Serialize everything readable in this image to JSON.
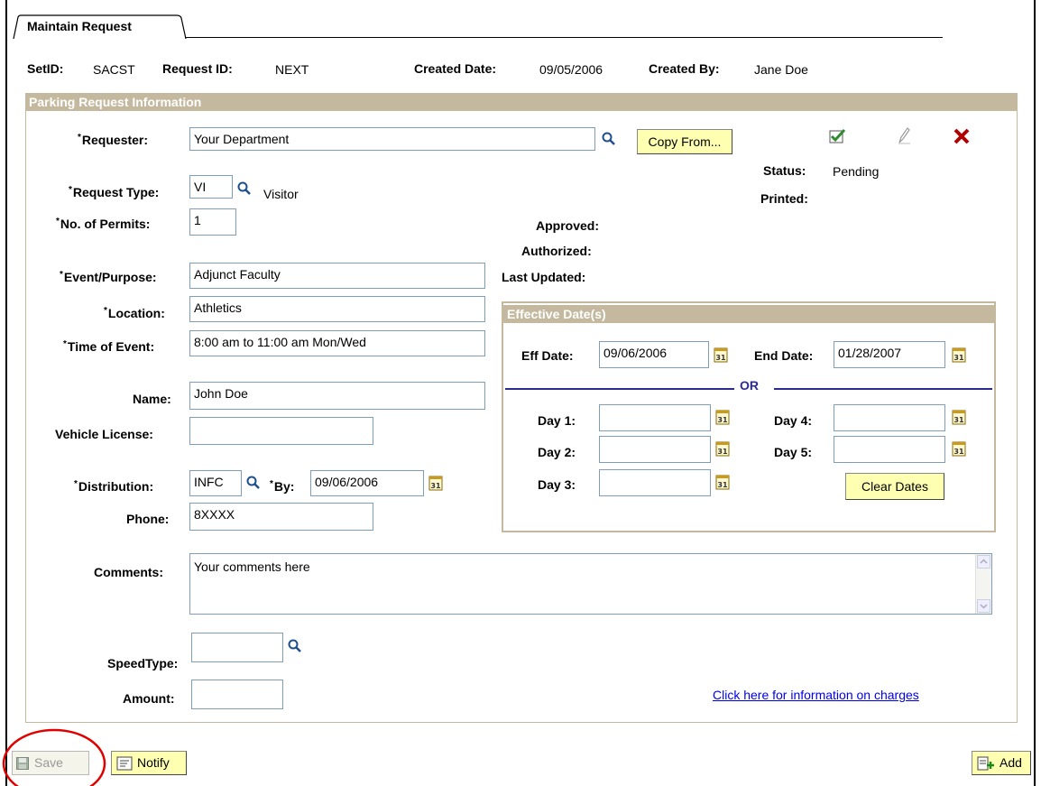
{
  "tab": {
    "label": "Maintain Request"
  },
  "header": {
    "setid_label": "SetID:",
    "setid_value": "SACST",
    "request_id_label": "Request ID:",
    "request_id_value": "NEXT",
    "created_date_label": "Created Date:",
    "created_date_value": "09/05/2006",
    "created_by_label": "Created By:",
    "created_by_value": "Jane Doe"
  },
  "section": {
    "title": "Parking Request Information"
  },
  "form": {
    "requester_label": "Requester:",
    "requester_value": "Your Department",
    "copy_from": "Copy From...",
    "status_label": "Status:",
    "status_value": "Pending",
    "printed_label": "Printed:",
    "request_type_label": "Request Type:",
    "request_type_value": "VI",
    "request_type_desc": "Visitor",
    "permits_label": "No. of Permits:",
    "permits_value": "1",
    "approved_label": "Approved:",
    "authorized_label": "Authorized:",
    "last_updated_label": "Last Updated:",
    "event_label": "Event/Purpose:",
    "event_value": "Adjunct Faculty",
    "location_label": "Location:",
    "location_value": "Athletics",
    "time_label": "Time of Event:",
    "time_value": "8:00 am to 11:00 am Mon/Wed",
    "name_label": "Name:",
    "name_value": "John Doe",
    "vehicle_label": "Vehicle License:",
    "vehicle_value": "",
    "distribution_label": "Distribution:",
    "distribution_value": "INFC",
    "by_label": "By:",
    "by_value": "09/06/2006",
    "phone_label": "Phone:",
    "phone_value": "8XXXX",
    "comments_label": "Comments:",
    "comments_value": "Your comments here",
    "speedtype_label": "SpeedType:",
    "speedtype_value": "",
    "amount_label": "Amount:",
    "amount_value": "",
    "charges_link": "Click here for information on charges"
  },
  "effective": {
    "title": "Effective Date(s)",
    "eff_label": "Eff Date:",
    "eff_value": "09/06/2006",
    "end_label": "End Date:",
    "end_value": "01/28/2007",
    "or_label": "OR",
    "day1_label": "Day 1:",
    "day2_label": "Day 2:",
    "day3_label": "Day 3:",
    "day4_label": "Day 4:",
    "day5_label": "Day 5:",
    "clear_dates": "Clear Dates"
  },
  "footer": {
    "save": "Save",
    "notify": "Notify",
    "add": "Add"
  },
  "colors": {
    "section_header": "#c4b99e",
    "button_bg": "#ffffb2",
    "link": "#0000ee",
    "or_line": "#2b2b8f",
    "highlight_circle": "#e00000"
  }
}
